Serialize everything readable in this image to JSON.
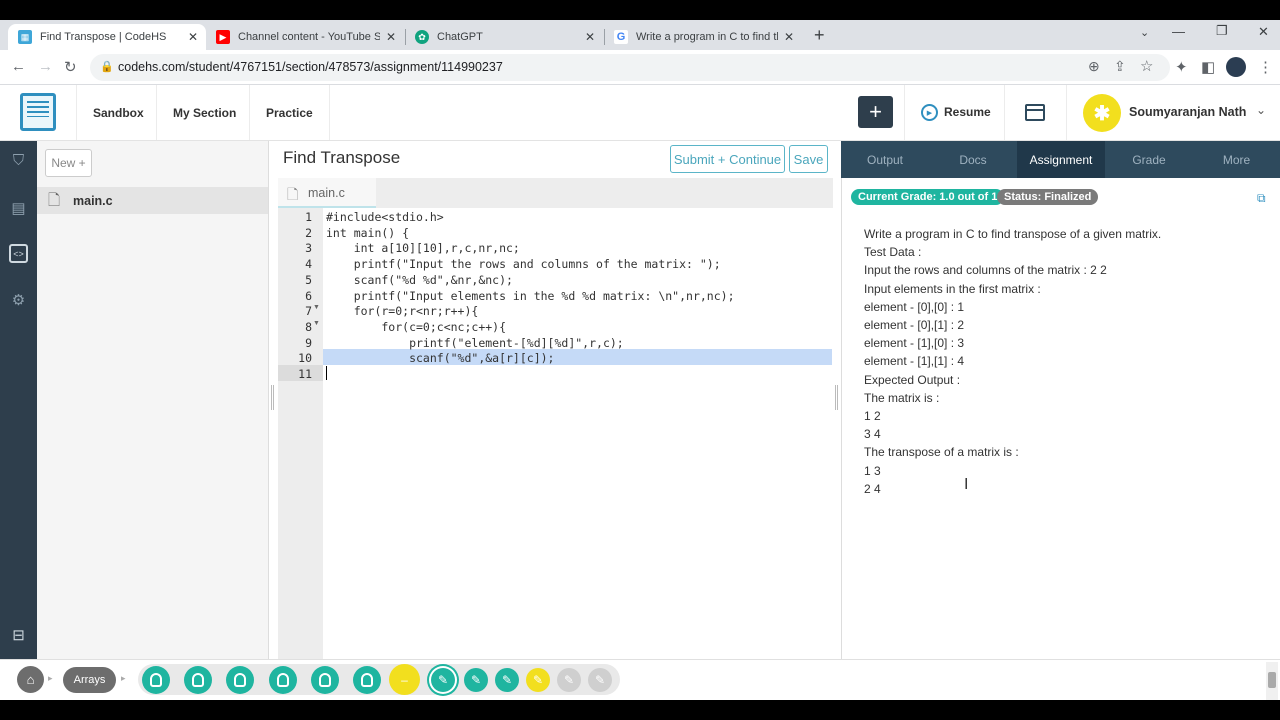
{
  "browser": {
    "tabs": [
      {
        "title": "Find Transpose | CodeHS",
        "icon": "codehs-favicon"
      },
      {
        "title": "Channel content - YouTube Studio",
        "icon": "youtube-favicon"
      },
      {
        "title": "ChatGPT",
        "icon": "chatgpt-favicon"
      },
      {
        "title": "Write a program in C to find the",
        "icon": "google-favicon"
      }
    ],
    "new_tab": "+",
    "url": "codehs.com/student/4767151/section/478573/assignment/114990237"
  },
  "header": {
    "nav": [
      "Sandbox",
      "My Section",
      "Practice"
    ],
    "add_label": "+",
    "resume_label": "Resume",
    "user_name": "Soumyaranjan Nath"
  },
  "files": {
    "new_label": "New +",
    "items": [
      "main.c"
    ]
  },
  "editor": {
    "title": "Find Transpose",
    "submit_label": "Submit + Continue",
    "save_label": "Save",
    "tab_label": "main.c",
    "lines": [
      "#include<stdio.h>",
      "int main() {",
      "    int a[10][10],r,c,nr,nc;",
      "    printf(\"Input the rows and columns of the matrix: \");",
      "    scanf(\"%d %d\",&nr,&nc);",
      "    printf(\"Input elements in the %d %d matrix: \\n\",nr,nc);",
      "    for(r=0;r<nr;r++){",
      "        for(c=0;c<nc;c++){",
      "            printf(\"element-[%d][%d]\",r,c);",
      "            scanf(\"%d\",&a[r][c]);",
      ""
    ],
    "line_numbers": [
      "1",
      "2",
      "3",
      "4",
      "5",
      "6",
      "7",
      "8",
      "9",
      "10",
      "11"
    ]
  },
  "right_panel": {
    "tabs": [
      "Output",
      "Docs",
      "Assignment",
      "Grade",
      "More"
    ],
    "active_tab": "Assignment",
    "grade_pill": "Current Grade: 1.0 out of 1",
    "status_pill": "Status: Finalized",
    "assignment_lines": [
      "Write a program in C to find transpose of a given matrix.",
      "Test Data :",
      "Input the rows and columns of the matrix : 2 2",
      "Input elements in the first matrix :",
      "element - [0],[0] : 1",
      "element - [0],[1] : 2",
      "element - [1],[0] : 3",
      "element - [1],[1] : 4",
      "Expected Output :",
      "The matrix is :",
      "1 2",
      "3 4",
      "The transpose of a matrix is :",
      "1 3",
      "2 4"
    ]
  },
  "bottom": {
    "arrays_label": "Arrays"
  },
  "colors": {
    "teal": "#1fb5a0",
    "yellow": "#f2df1e",
    "sidebar": "#2e3e4c",
    "tabs_bg": "#2e4a5d",
    "highlight": "#c5daf7"
  }
}
